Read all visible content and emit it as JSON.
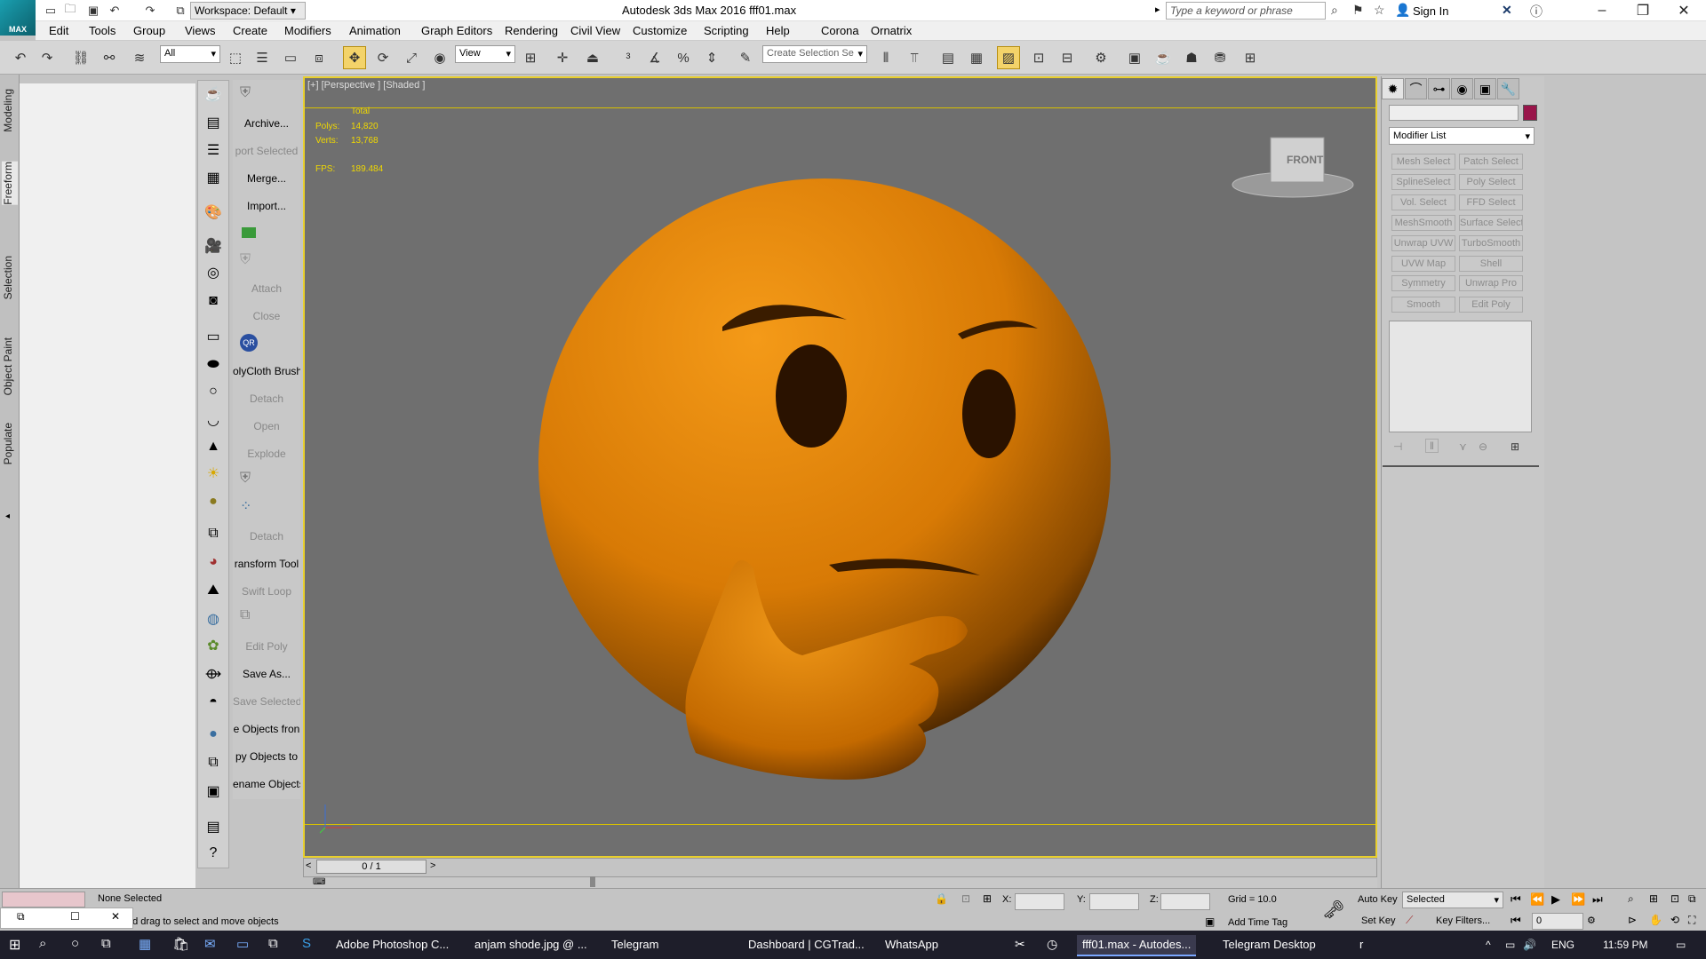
{
  "app": {
    "logo_label": "MAX",
    "workspace": "Workspace: Default",
    "title": "Autodesk 3ds Max 2016     fff01.max",
    "search_placeholder": "Type a keyword or phrase",
    "sign_in": "Sign In"
  },
  "menu": [
    "Edit",
    "Tools",
    "Group",
    "Views",
    "Create",
    "Modifiers",
    "Animation",
    "Graph Editors",
    "Rendering",
    "Civil View",
    "Customize",
    "Scripting",
    "Help",
    "Corona",
    "Ornatrix"
  ],
  "toolbar": {
    "filter": "All",
    "ref_coord": "View",
    "selection_set": "Create Selection Se"
  },
  "ribbon_tabs": [
    "Modeling",
    "Freeform",
    "Selection",
    "Object Paint",
    "Populate"
  ],
  "commands": [
    {
      "label": "Archive...",
      "disabled": false
    },
    {
      "label": "port Selected",
      "disabled": true
    },
    {
      "label": "Merge...",
      "disabled": false
    },
    {
      "label": "Import...",
      "disabled": false
    },
    {
      "label": "Attach",
      "disabled": true
    },
    {
      "label": "Close",
      "disabled": true
    },
    {
      "label": "olyCloth Brush",
      "disabled": false
    },
    {
      "label": "Detach",
      "disabled": true
    },
    {
      "label": "Open",
      "disabled": true
    },
    {
      "label": "Explode",
      "disabled": true
    },
    {
      "label": "Detach",
      "disabled": true
    },
    {
      "label": "ransform Tool",
      "disabled": false
    },
    {
      "label": "Swift Loop",
      "disabled": true
    },
    {
      "label": "Edit Poly",
      "disabled": true
    },
    {
      "label": "Save As...",
      "disabled": false
    },
    {
      "label": "Save Selected",
      "disabled": true
    },
    {
      "label": "e Objects fron",
      "disabled": false
    },
    {
      "label": "py Objects to",
      "disabled": false
    },
    {
      "label": "ename Objects",
      "disabled": false
    }
  ],
  "viewport": {
    "label": "[+] [Perspective ] [Shaded ]",
    "stats_header": "Total",
    "polys_label": "Polys:",
    "polys": "14,820",
    "verts_label": "Verts:",
    "verts": "13,768",
    "fps_label": "FPS:",
    "fps": "189.484",
    "viewcube_label": "FRONT"
  },
  "timeline": {
    "frame": "0 / 1"
  },
  "command_panel": {
    "modifier_list": "Modifier List",
    "modifiers": [
      "Mesh Select",
      "Patch Select",
      "SplineSelect",
      "Poly Select",
      "Vol. Select",
      "FFD Select",
      "MeshSmooth",
      "Surface Select",
      "Unwrap UVW",
      "TurboSmooth",
      "UVW Map",
      "Shell",
      "Symmetry",
      "Unwrap Pro",
      "Smooth",
      "Edit Poly"
    ]
  },
  "status": {
    "selection": "None Selected",
    "prompt": "Click and drag to select and move objects",
    "x_label": "X:",
    "y_label": "Y:",
    "z_label": "Z:",
    "grid": "Grid = 10.0",
    "add_time_tag": "Add Time Tag",
    "auto_key": "Auto Key",
    "set_key": "Set Key",
    "key_mode": "Selected",
    "key_filters": "Key Filters...",
    "frame_value": "0"
  },
  "taskbar": {
    "items": [
      "Adobe Photoshop C...",
      "anjam shode.jpg @ ...",
      "Telegram",
      "Dashboard | CGTrad...",
      "WhatsApp",
      "fff01.max - Autodes...",
      "Telegram Desktop",
      "r"
    ],
    "lang": "ENG",
    "time": "11:59 PM"
  },
  "colors": {
    "viewport_border": "#e8cf2e",
    "emoji": "#e08a0c",
    "object_color": "#99154a"
  }
}
